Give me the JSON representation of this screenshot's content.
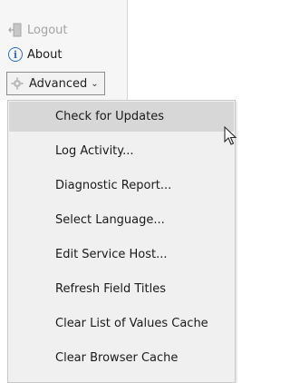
{
  "ribbon": {
    "logout_label": "Logout",
    "about_label": "About",
    "advanced_label": "Advanced"
  },
  "menu": {
    "items": [
      {
        "label": "Check for Updates",
        "hovered": true
      },
      {
        "label": "Log Activity..."
      },
      {
        "label": "Diagnostic Report..."
      },
      {
        "label": "Select Language..."
      },
      {
        "label": "Edit Service Host..."
      },
      {
        "label": "Refresh Field Titles"
      },
      {
        "label": "Clear List of Values Cache"
      },
      {
        "label": "Clear Browser Cache"
      }
    ]
  },
  "icons": {
    "logout": "logout-icon",
    "about": "info-icon",
    "advanced": "gear-icon",
    "chevron": "chevron-down-icon",
    "cursor": "mouse-cursor-icon"
  },
  "colors": {
    "hover_bg": "#d7d7d7",
    "menu_bg": "#f0f0f0",
    "about_icon": "#2f6fbf",
    "disabled_text": "#a3a3a3"
  }
}
